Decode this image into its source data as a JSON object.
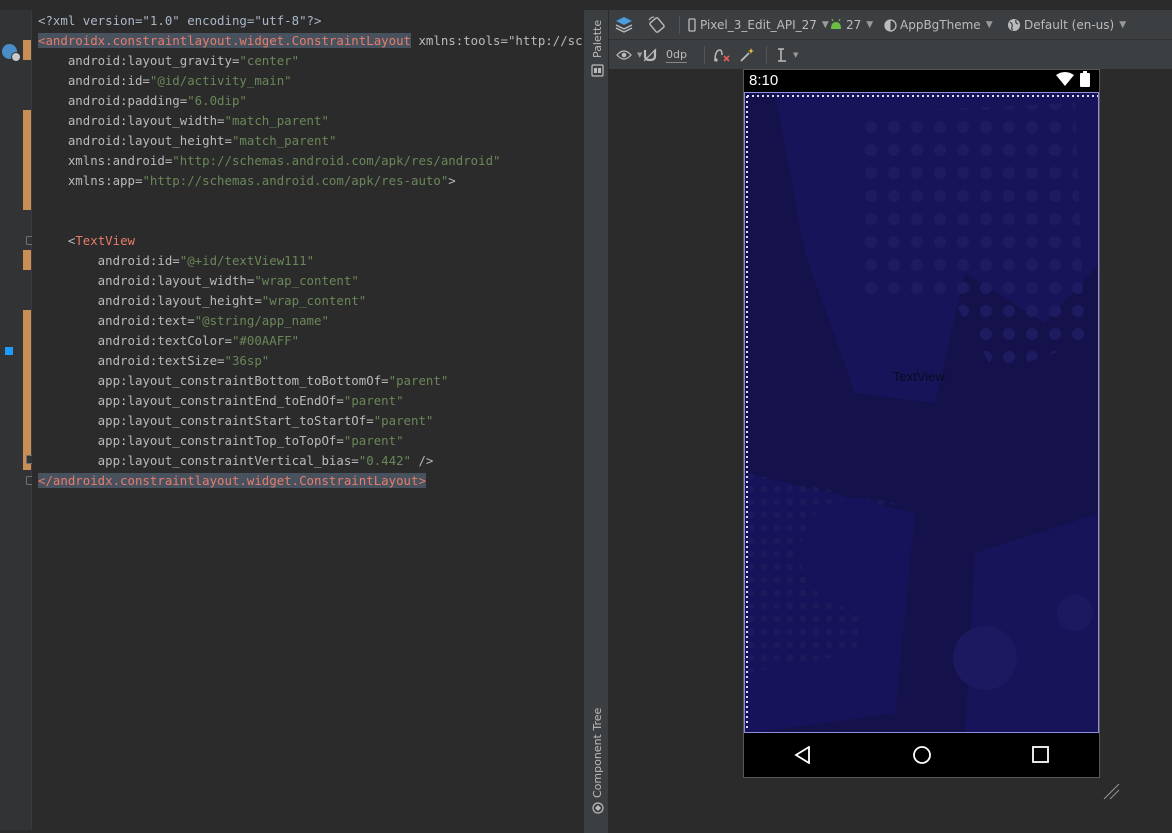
{
  "editor": {
    "lines": [
      [
        {
          "c": "c-pi",
          "t": "<?xml version=\"1.0\" encoding=\"utf-8\"?>"
        }
      ],
      [
        {
          "c": "c-tag-hl",
          "t": "<androidx.constraintlayout.widget.ConstraintLayout"
        },
        {
          "c": "c-attr",
          "t": " xmlns:tools=\"http://schemas"
        }
      ],
      [
        {
          "c": "c-attr",
          "t": "    android:layout_gravity="
        },
        {
          "c": "c-val",
          "t": "\"center\""
        }
      ],
      [
        {
          "c": "c-attr",
          "t": "    android:id="
        },
        {
          "c": "c-val",
          "t": "\"@id/activity_main\""
        }
      ],
      [
        {
          "c": "c-attr",
          "t": "    android:padding="
        },
        {
          "c": "c-val",
          "t": "\"6.0dip\""
        }
      ],
      [
        {
          "c": "c-attr",
          "t": "    android:layout_width="
        },
        {
          "c": "c-val",
          "t": "\"match_parent\""
        }
      ],
      [
        {
          "c": "c-attr",
          "t": "    android:layout_height="
        },
        {
          "c": "c-val",
          "t": "\"match_parent\""
        }
      ],
      [
        {
          "c": "c-attr",
          "t": "    xmlns:android="
        },
        {
          "c": "c-val",
          "t": "\"http://schemas.android.com/apk/res/android\""
        }
      ],
      [
        {
          "c": "c-attr",
          "t": "    xmlns:app="
        },
        {
          "c": "c-val",
          "t": "\"http://schemas.android.com/apk/res-auto\""
        },
        {
          "c": "c-attr",
          "t": ">"
        }
      ],
      [],
      [],
      [
        {
          "c": "c-attr",
          "t": "    <"
        },
        {
          "c": "c-tv",
          "t": "TextView"
        }
      ],
      [
        {
          "c": "c-attr",
          "t": "        android:id="
        },
        {
          "c": "c-val",
          "t": "\"@+id/textView111\""
        }
      ],
      [
        {
          "c": "c-attr",
          "t": "        android:layout_width="
        },
        {
          "c": "c-val",
          "t": "\"wrap_content\""
        }
      ],
      [
        {
          "c": "c-attr",
          "t": "        android:layout_height="
        },
        {
          "c": "c-val",
          "t": "\"wrap_content\""
        }
      ],
      [
        {
          "c": "c-attr",
          "t": "        android:text="
        },
        {
          "c": "c-val",
          "t": "\"@string/app_name\""
        }
      ],
      [
        {
          "c": "c-attr",
          "t": "        android:textColor="
        },
        {
          "c": "c-val",
          "t": "\"#00AAFF\""
        }
      ],
      [
        {
          "c": "c-attr",
          "t": "        android:textSize="
        },
        {
          "c": "c-val",
          "t": "\"36sp\""
        }
      ],
      [
        {
          "c": "c-attr",
          "t": "        app:layout_constraintBottom_toBottomOf="
        },
        {
          "c": "c-val",
          "t": "\"parent\""
        }
      ],
      [
        {
          "c": "c-attr",
          "t": "        app:layout_constraintEnd_toEndOf="
        },
        {
          "c": "c-val",
          "t": "\"parent\""
        }
      ],
      [
        {
          "c": "c-attr",
          "t": "        app:layout_constraintStart_toStartOf="
        },
        {
          "c": "c-val",
          "t": "\"parent\""
        }
      ],
      [
        {
          "c": "c-attr",
          "t": "        app:layout_constraintTop_toTopOf="
        },
        {
          "c": "c-val",
          "t": "\"parent\""
        }
      ],
      [
        {
          "c": "c-attr",
          "t": "        app:layout_constraintVertical_bias="
        },
        {
          "c": "c-val",
          "t": "\"0.442\""
        },
        {
          "c": "c-attr",
          "t": " />"
        }
      ],
      [
        {
          "c": "c-tag-hl",
          "t": "</androidx.constraintlayout.widget.ConstraintLayout>"
        }
      ]
    ]
  },
  "side_strip": {
    "palette_label": "Palette",
    "component_tree_label": "Component Tree"
  },
  "toolbar": {
    "device": "Pixel_3_Edit_API_27",
    "api": "27",
    "theme": "AppBgTheme",
    "locale": "Default (en-us)",
    "margin": "0dp"
  },
  "preview": {
    "time": "8:10",
    "textview_label": "TextView"
  },
  "colors": {
    "screen_bg": "#14114b",
    "accent": "#4b91d6",
    "modified": "#c88e55"
  },
  "icons": {
    "design-surface": "layers-icon",
    "orientation": "rotate-icon",
    "device": "phone-icon",
    "api": "android-icon",
    "theme": "theme-icon",
    "locale": "globe-icon",
    "eye": "eye-icon",
    "magnet": "magnet-icon",
    "clear": "clear-constraints-icon",
    "infer": "magic-wand-icon",
    "guidelines": "guideline-icon"
  }
}
